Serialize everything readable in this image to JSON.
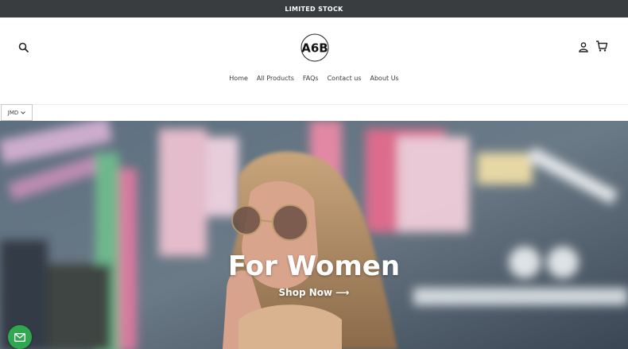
{
  "announcement": {
    "text": "LIMITED STOCK"
  },
  "header": {
    "logo_text": "A6B",
    "search_icon": "search-icon",
    "account_icon": "account-icon",
    "cart_icon": "cart-icon"
  },
  "nav": {
    "items": [
      {
        "label": "Home"
      },
      {
        "label": "All Products"
      },
      {
        "label": "FAQs"
      },
      {
        "label": "Contact us"
      },
      {
        "label": "About Us"
      }
    ]
  },
  "currency": {
    "selected": "JMD",
    "icon": "chevron-down-icon"
  },
  "hero": {
    "title": "For Women",
    "cta_label": "Shop Now",
    "cta_arrow": "⟶"
  },
  "chat": {
    "icon": "mail-icon",
    "color": "#2fa84f"
  },
  "colors": {
    "announcement_bg": "#3a3d40",
    "text": "#3a3a3a",
    "white": "#ffffff"
  }
}
